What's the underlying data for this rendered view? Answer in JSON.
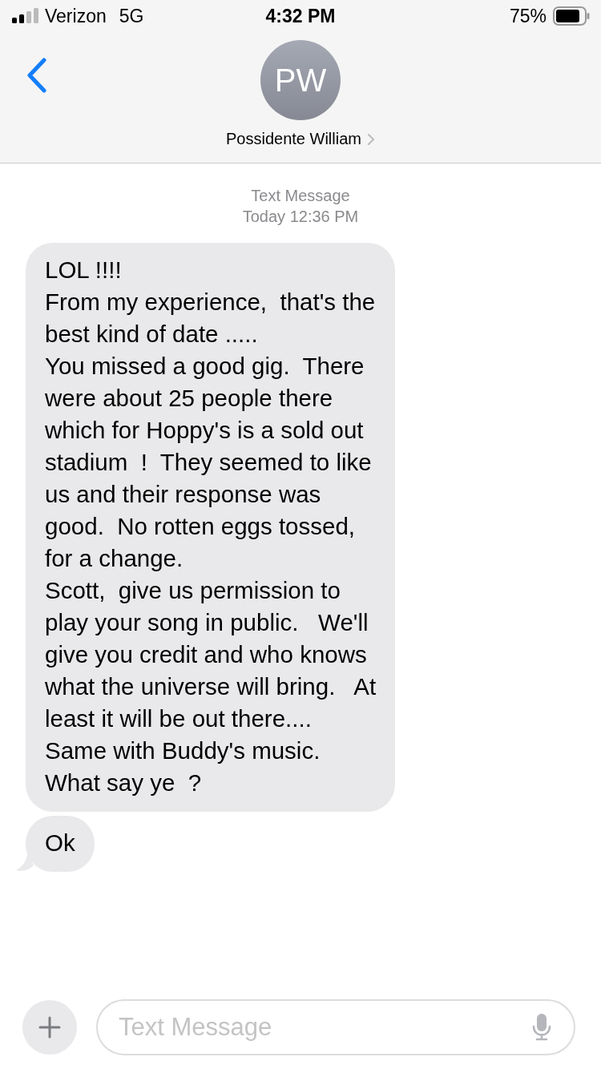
{
  "status_bar": {
    "carrier": "Verizon",
    "network": "5G",
    "time": "4:32 PM",
    "battery": "75%"
  },
  "header": {
    "avatar_initials": "PW",
    "contact_name": "Possidente William"
  },
  "timestamp": {
    "service": "Text Message",
    "time": "Today 12:36 PM"
  },
  "messages": [
    {
      "kind": "received",
      "lines": [
        "LOL !!!!",
        "From my experience,  that's the",
        "best kind of date .....",
        "You missed a good gig.  There",
        "were about 25 people there",
        "which for Hoppy's is a sold out",
        "stadium  !  They seemed to like",
        "us and their response was",
        "good.  No rotten eggs tossed,",
        "for a change.",
        "Scott,  give us permission to",
        "play your song in public.   We'll",
        "give you credit and who knows",
        "what the universe will bring.   At",
        "least it will be out there....",
        "Same with Buddy's music.",
        "What say ye  ?"
      ]
    },
    {
      "kind": "received",
      "lines": [
        "Ok"
      ]
    }
  ],
  "composer": {
    "placeholder": "Text Message"
  }
}
